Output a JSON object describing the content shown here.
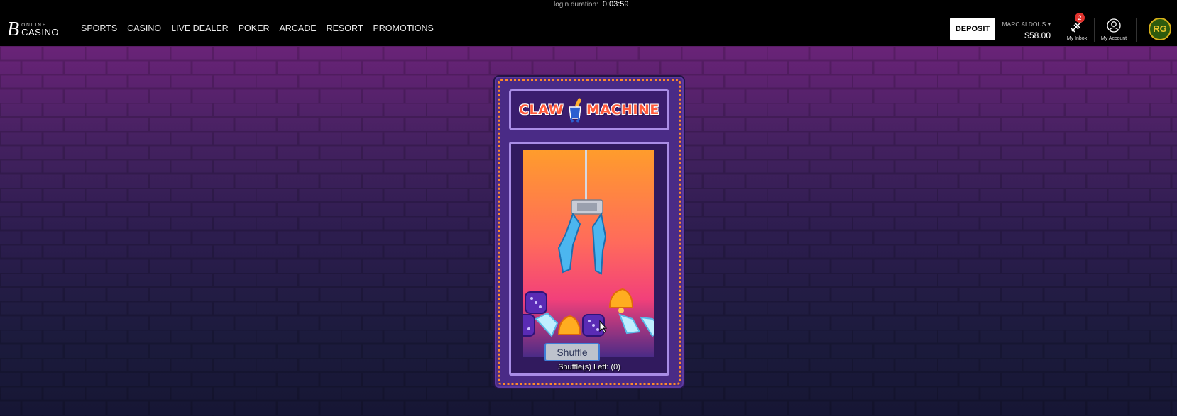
{
  "header": {
    "login_label": "login duration:",
    "login_value": "0:03:59",
    "logo": {
      "online": "ONLINE",
      "casino": "CASINO"
    },
    "nav": [
      "SPORTS",
      "CASINO",
      "LIVE DEALER",
      "POKER",
      "ARCADE",
      "RESORT",
      "PROMOTIONS"
    ],
    "deposit_label": "DEPOSIT",
    "user_name": "MARC ALDOUS",
    "balance": "$58.00",
    "inbox_label": "My Inbox",
    "inbox_count": "2",
    "account_label": "My Account",
    "rg_label": "RG"
  },
  "game": {
    "title_part1": "CLAW",
    "title_part2": "MACHINE",
    "shuffle_label": "Shuffle",
    "shuffles_left": "Shuffle(s) Left: (0)",
    "prizes": [
      "dice",
      "bell",
      "dice",
      "diamond",
      "bell",
      "dice",
      "diamond",
      "diamond",
      "diamond"
    ]
  },
  "colors": {
    "accent_orange": "#ff8a2a",
    "cabinet_purple": "#4a2b86",
    "deposit_bg": "#ffffff",
    "badge_red": "#e0322d"
  }
}
